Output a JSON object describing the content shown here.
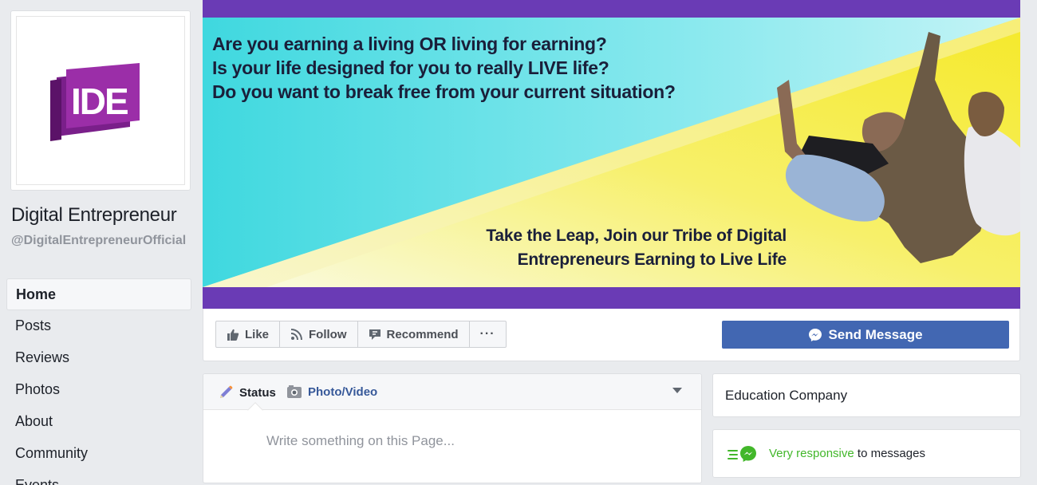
{
  "sidebar": {
    "logo_text": "IDE",
    "page_name": "Digital Entrepreneur",
    "handle": "@DigitalEntrepreneurOfficial",
    "nav": [
      {
        "label": "Home",
        "active": true
      },
      {
        "label": "Posts"
      },
      {
        "label": "Reviews"
      },
      {
        "label": "Photos"
      },
      {
        "label": "About"
      },
      {
        "label": "Community"
      },
      {
        "label": "Events"
      }
    ]
  },
  "cover": {
    "question_1": "Are you earning a living OR living for earning?",
    "question_2": "Is your life designed for you to really LIVE life?",
    "question_3": "Do you want to break free from your current situation?",
    "cta_1": "Take the Leap, Join our Tribe of Digital",
    "cta_2": "Entrepreneurs Earning to Live Life",
    "colors": {
      "band": "#6a3bb5",
      "cyan": "#5fe0e6",
      "yellow": "#f5ee3b"
    }
  },
  "actions": {
    "like": "Like",
    "follow": "Follow",
    "recommend": "Recommend",
    "more": "···",
    "send_message": "Send Message"
  },
  "composer": {
    "status_tab": "Status",
    "photo_tab": "Photo/Video",
    "placeholder": "Write something on this Page..."
  },
  "about": {
    "category": "Education Company",
    "responsive_highlight": "Very responsive",
    "responsive_rest": " to messages"
  },
  "colors": {
    "brand": "#4267b2",
    "link": "#365899",
    "green": "#42b72a"
  }
}
